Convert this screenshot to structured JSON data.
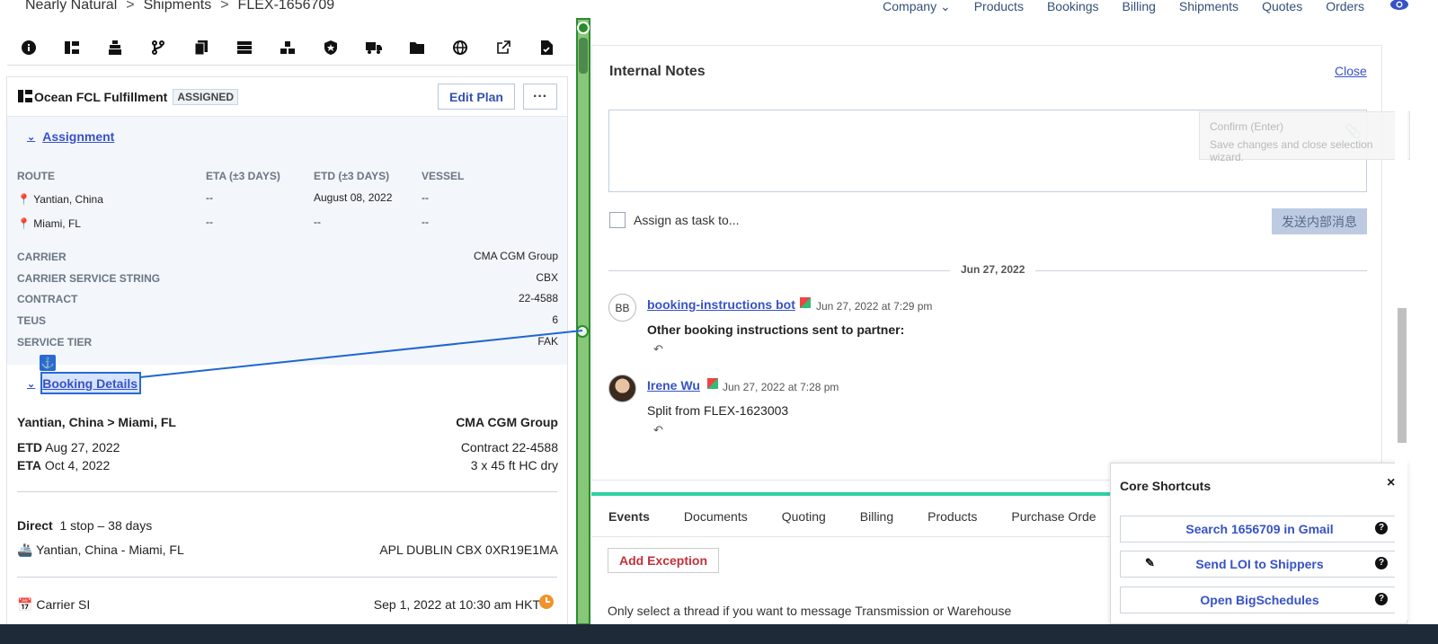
{
  "breadcrumb": {
    "items": [
      "Nearly Natural",
      "Shipments",
      "FLEX-1656709"
    ],
    "separator": ">"
  },
  "topnav": {
    "items": [
      "Company",
      "Products",
      "Bookings",
      "Billing",
      "Shipments",
      "Quotes",
      "Orders"
    ]
  },
  "plan": {
    "title": "Ocean FCL Fulfillment",
    "status": "ASSIGNED",
    "edit_label": "Edit Plan",
    "more_label": "···"
  },
  "assignment": {
    "heading": "Assignment",
    "columns": [
      "ROUTE",
      "ETA (±3 DAYS)",
      "ETD (±3 DAYS)",
      "VESSEL"
    ],
    "rows": [
      {
        "route": "Yantian, China",
        "eta": "--",
        "etd": "August 08, 2022",
        "vessel": "--"
      },
      {
        "route": "Miami, FL",
        "eta": "--",
        "etd": "--",
        "vessel": "--"
      }
    ],
    "details": [
      {
        "key": "CARRIER",
        "value": "CMA CGM Group"
      },
      {
        "key": "CARRIER SERVICE STRING",
        "value": "CBX"
      },
      {
        "key": "CONTRACT",
        "value": "22-4588"
      },
      {
        "key": "TEUS",
        "value": "6"
      },
      {
        "key": "SERVICE TIER",
        "value": "FAK"
      }
    ]
  },
  "booking": {
    "heading": "Booking Details",
    "lane": "Yantian, China > Miami, FL",
    "carrier": "CMA CGM Group",
    "etd_label": "ETD",
    "etd": "Aug 27, 2022",
    "eta_label": "ETA",
    "eta": "Oct 4, 2022",
    "contract": "Contract 22-4588",
    "equipment": "3 x 45 ft HC dry",
    "routing_type": "Direct",
    "routing_detail": "1 stop – 38 days",
    "leg": "Yantian, China - Miami, FL",
    "vessel": "APL DUBLIN CBX 0XR19E1MA",
    "milestone": "Carrier SI",
    "milestone_time": "Sep 1, 2022 at 10:30 am HKT"
  },
  "notes": {
    "title": "Internal Notes",
    "close_label": "Close",
    "tooltip_title": "Confirm (Enter)",
    "tooltip_body": "Save changes and close selection wizard.",
    "assign_label": "Assign as task to...",
    "send_label": "发送内部消息",
    "date_divider": "Jun 27, 2022",
    "messages": [
      {
        "initials": "BB",
        "author": "booking-instructions bot",
        "time": "Jun 27, 2022 at 7:29 pm",
        "body": "Other booking instructions sent to partner:"
      },
      {
        "initials": "",
        "author": "Irene Wu",
        "time": "Jun 27, 2022 at 7:28 pm",
        "body": "Split from FLEX-1623003"
      }
    ]
  },
  "tabs": [
    "Events",
    "Documents",
    "Quoting",
    "Billing",
    "Products",
    "Purchase Orde"
  ],
  "events": {
    "add_exception": "Add Exception",
    "thread_note": "Only select a thread if you want to message Transmission or Warehouse"
  },
  "shortcuts": {
    "title": "Core Shortcuts",
    "close": "×",
    "items": [
      "Search 1656709 in Gmail",
      "Send LOI to Shippers",
      "Open BigSchedules"
    ]
  },
  "colors": {
    "link": "#3752c6",
    "accent_tab": "#2ed1a4",
    "danger": "#c3303b",
    "splitter": "#86c779"
  }
}
